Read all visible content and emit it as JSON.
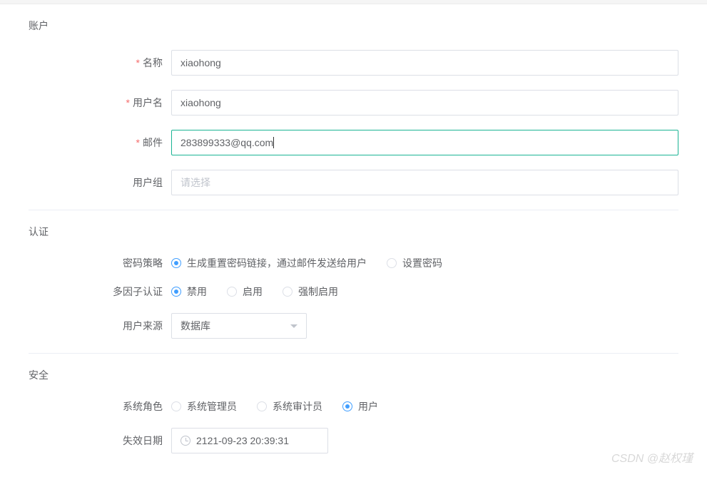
{
  "sections": {
    "account": {
      "title": "账户",
      "fields": {
        "name_label": "名称",
        "name_value": "xiaohong",
        "username_label": "用户名",
        "username_value": "xiaohong",
        "email_label": "邮件",
        "email_value": "283899333@qq.com",
        "group_label": "用户组",
        "group_placeholder": "请选择"
      }
    },
    "auth": {
      "title": "认证",
      "fields": {
        "password_policy_label": "密码策略",
        "password_policy_options": {
          "opt1": "生成重置密码链接，通过邮件发送给用户",
          "opt2": "设置密码"
        },
        "mfa_label": "多因子认证",
        "mfa_options": {
          "opt1": "禁用",
          "opt2": "启用",
          "opt3": "强制启用"
        },
        "source_label": "用户来源",
        "source_value": "数据库"
      }
    },
    "security": {
      "title": "安全",
      "fields": {
        "role_label": "系统角色",
        "role_options": {
          "opt1": "系统管理员",
          "opt2": "系统审计员",
          "opt3": "用户"
        },
        "expiry_label": "失效日期",
        "expiry_value": "2121-09-23 20:39:31"
      }
    }
  },
  "watermark": "CSDN @赵权瑾"
}
